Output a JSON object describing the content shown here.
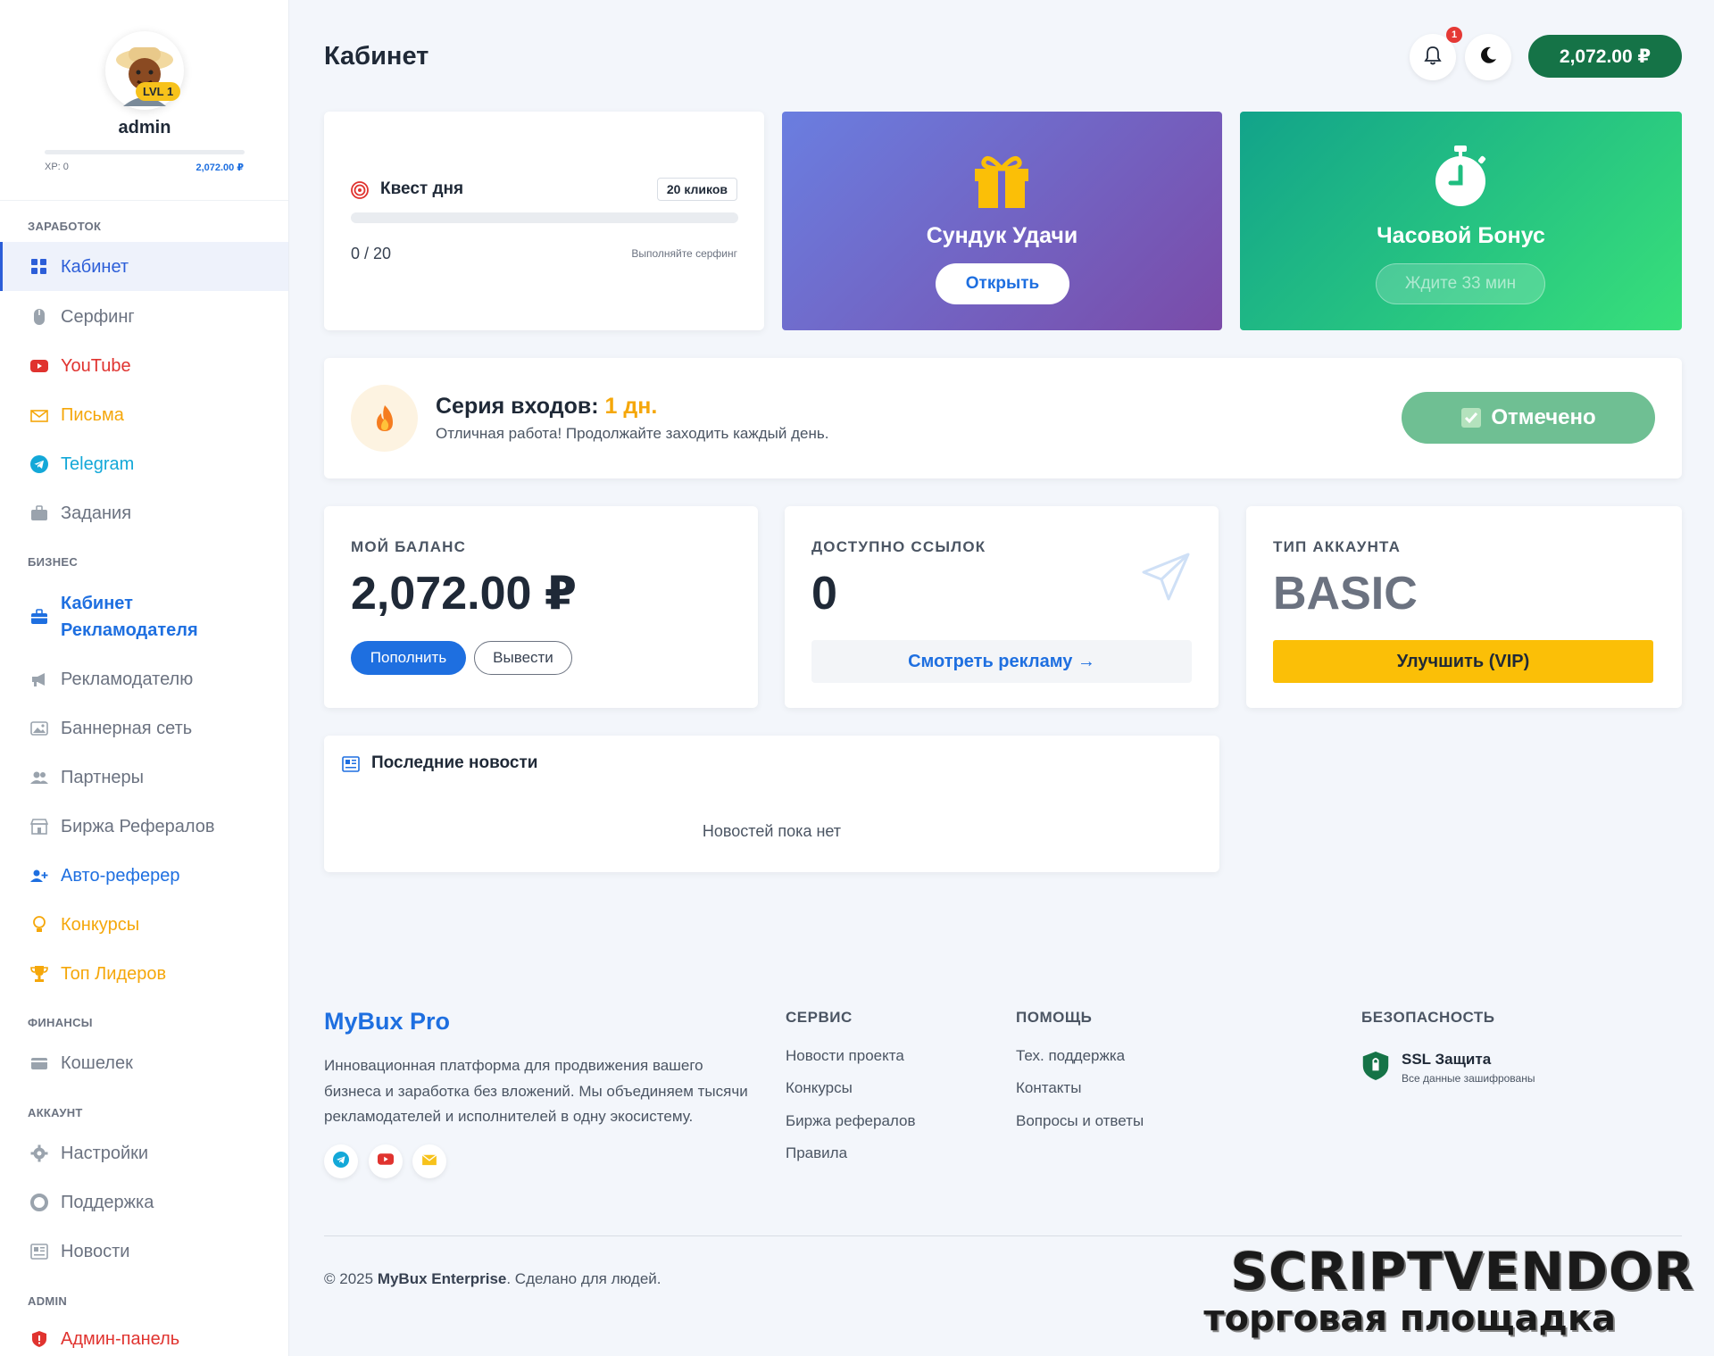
{
  "sidebar": {
    "profile": {
      "username": "admin",
      "level": "LVL 1",
      "xp_label": "XP: 0",
      "balance": "2,072.00 ₽"
    },
    "sections": {
      "earn": "ЗАРАБОТОК",
      "business": "БИЗНЕС",
      "finance": "ФИНАНСЫ",
      "account": "АККАУНТ",
      "admin": "ADMIN"
    },
    "items": {
      "cabinet": "Кабинет",
      "surfing": "Серфинг",
      "youtube": "YouTube",
      "letters": "Письма",
      "telegram": "Telegram",
      "tasks": "Задания",
      "adv_cabinet": "Кабинет Рекламодателя",
      "to_advertiser": "Рекламодателю",
      "banner_net": "Баннерная сеть",
      "partners": "Партнеры",
      "ref_exchange": "Биржа Рефералов",
      "auto_ref": "Авто-реферер",
      "contests": "Конкурсы",
      "top_leaders": "Топ Лидеров",
      "wallet": "Кошелек",
      "settings": "Настройки",
      "support": "Поддержка",
      "news": "Новости",
      "admin_panel": "Админ-панель"
    }
  },
  "header": {
    "title": "Кабинет",
    "notifications_count": "1",
    "balance": "2,072.00 ₽"
  },
  "quest": {
    "title": "Квест дня",
    "badge": "20 кликов",
    "progress": "0 / 20",
    "progress_fraction": 0,
    "hint": "Выполняйте серфинг"
  },
  "chest": {
    "title": "Сундук Удачи",
    "button": "Открыть"
  },
  "hourly": {
    "title": "Часовой Бонус",
    "button": "Ждите 33 мин"
  },
  "streak": {
    "title": "Серия входов:",
    "value": "1 дн.",
    "subtitle": "Отличная работа! Продолжайте заходить каждый день.",
    "button": "Отмечено"
  },
  "stats": {
    "balance": {
      "label": "МОЙ БАЛАНС",
      "value": "2,072.00 ₽",
      "deposit": "Пополнить",
      "withdraw": "Вывести"
    },
    "links": {
      "label": "ДОСТУПНО ССЫЛОК",
      "value": "0",
      "button": "Смотреть рекламу →"
    },
    "account": {
      "label": "ТИП АККАУНТА",
      "value": "BASIC",
      "button": "Улучшить (VIP)"
    }
  },
  "news": {
    "title": "Последние новости",
    "empty": "Новостей пока нет"
  },
  "footer": {
    "brand": "MyBux Pro",
    "description": "Инновационная платформа для продвижения вашего бизнеса и заработка без вложений. Мы объединяем тысячи рекламодателей и исполнителей в одну экосистему.",
    "service": {
      "head": "СЕРВИС",
      "links": [
        "Новости проекта",
        "Конкурсы",
        "Биржа рефералов",
        "Правила"
      ]
    },
    "help": {
      "head": "ПОМОЩЬ",
      "links": [
        "Тех. поддержка",
        "Контакты",
        "Вопросы и ответы"
      ]
    },
    "security": {
      "head": "БЕЗОПАСНОСТЬ",
      "ssl_title": "SSL Защита",
      "ssl_sub": "Все данные зашифрованы"
    },
    "copyright_prefix": "© 2025",
    "copyright_brand": "MyBux Enterprise",
    "copyright_suffix": ". Сделано для людей."
  },
  "watermark": {
    "line1": "SCRIPTVENDOR",
    "line2": "торговая площадка"
  },
  "colors": {
    "primary": "#1e6fe0",
    "green": "#157347",
    "orange": "#f5a70a",
    "purple_start": "#6a7ee0",
    "purple_end": "#7a4ba8",
    "teal_start": "#12a38a",
    "teal_end": "#38e07a"
  }
}
